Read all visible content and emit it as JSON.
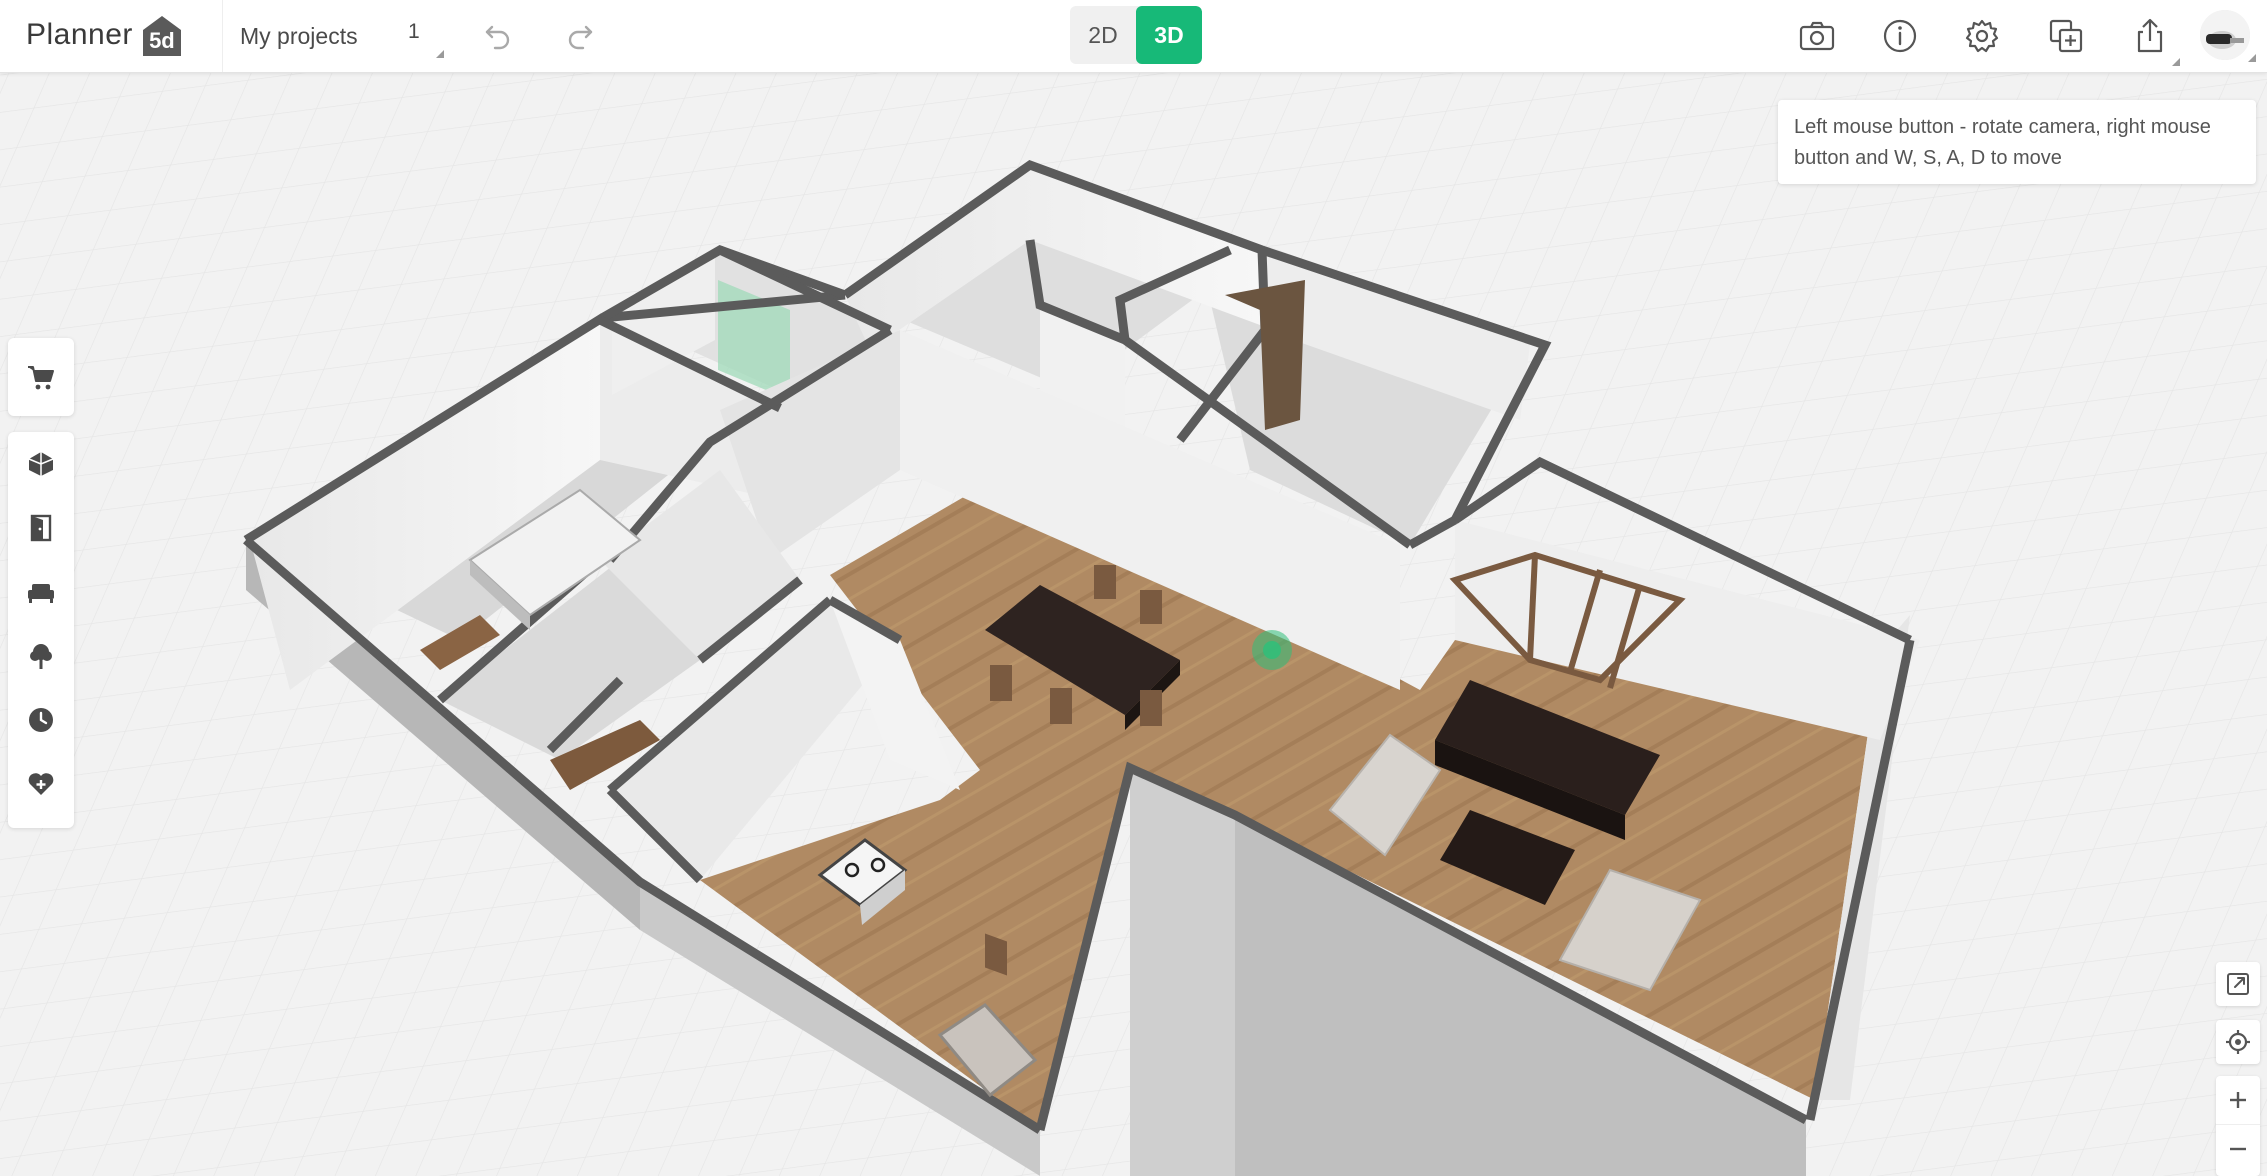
{
  "app": {
    "brand_text": "Planner",
    "brand_badge": "5d"
  },
  "header": {
    "projects_label": "My projects",
    "project_number": "1",
    "view_2d": "2D",
    "view_3d": "3D",
    "active_view": "3D"
  },
  "hint": {
    "text": "Left mouse button - rotate camera, right mouse button and W, S, A, D to move"
  },
  "icons": {
    "top_right": [
      "camera-icon",
      "info-icon",
      "gear-icon",
      "add-copy-icon",
      "share-icon",
      "avatar"
    ],
    "left_toolbar": [
      "cart-icon",
      "structure-icon",
      "door-icon",
      "sofa-icon",
      "tree-icon",
      "history-icon",
      "favorites-icon"
    ],
    "viewport_controls": [
      "expand-icon",
      "locate-icon",
      "zoom-in-icon",
      "zoom-out-icon"
    ]
  },
  "colors": {
    "accent": "#17b978",
    "wall_top": "#555555",
    "floor": "#b08a63",
    "dining_table": "#2e2320",
    "sofa": "#2a1f1c"
  }
}
